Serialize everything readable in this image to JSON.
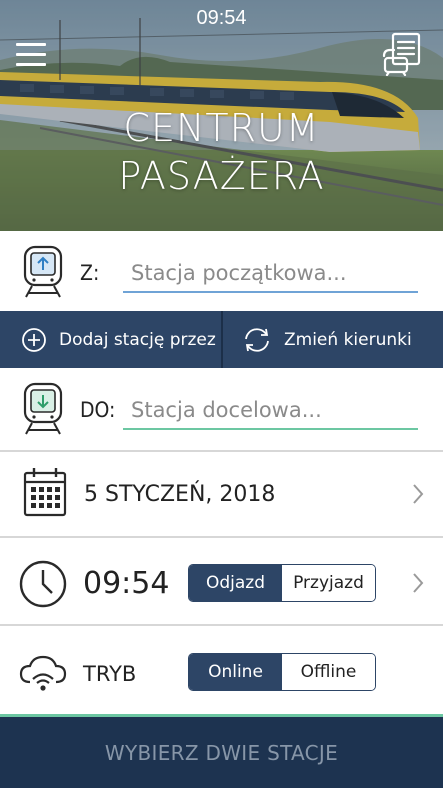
{
  "status_bar": {
    "time": "09:54"
  },
  "hero": {
    "title_line1": "CENTRUM",
    "title_line2": "PASAŻERA",
    "menu_icon": "hamburger-menu-icon",
    "ticket_icon": "ticket-list-icon"
  },
  "from": {
    "label": "Z:",
    "placeholder": "Stacja początkowa...",
    "value": "",
    "icon": "station-departure-icon",
    "underline_color": "#6fa3d6"
  },
  "actions": {
    "add_via_label": "Dodaj stację przez",
    "reverse_label": "Zmień kierunki",
    "add_icon": "plus-circle-icon",
    "reverse_icon": "swap-arrows-icon"
  },
  "to": {
    "label": "DO:",
    "placeholder": "Stacja docelowa...",
    "value": "",
    "icon": "station-arrival-icon",
    "underline_color": "#6cc7a2"
  },
  "date": {
    "value": "5 STYCZEŃ, 2018",
    "icon": "calendar-icon"
  },
  "time": {
    "value": "09:54",
    "icon": "clock-icon",
    "options": [
      "Odjazd",
      "Przyjazd"
    ],
    "selected": "Odjazd"
  },
  "mode": {
    "label": "TRYB",
    "icon": "cloud-wifi-icon",
    "options": [
      "Online",
      "Offline"
    ],
    "selected": "Online"
  },
  "submit": {
    "label": "WYBIERZ DWIE STACJE"
  },
  "colors": {
    "primary": "#2d4566",
    "submit_bg": "#1d3350",
    "submit_text": "#8796a8",
    "accent_green": "#6cc7a2",
    "accent_blue": "#6fa3d6"
  }
}
